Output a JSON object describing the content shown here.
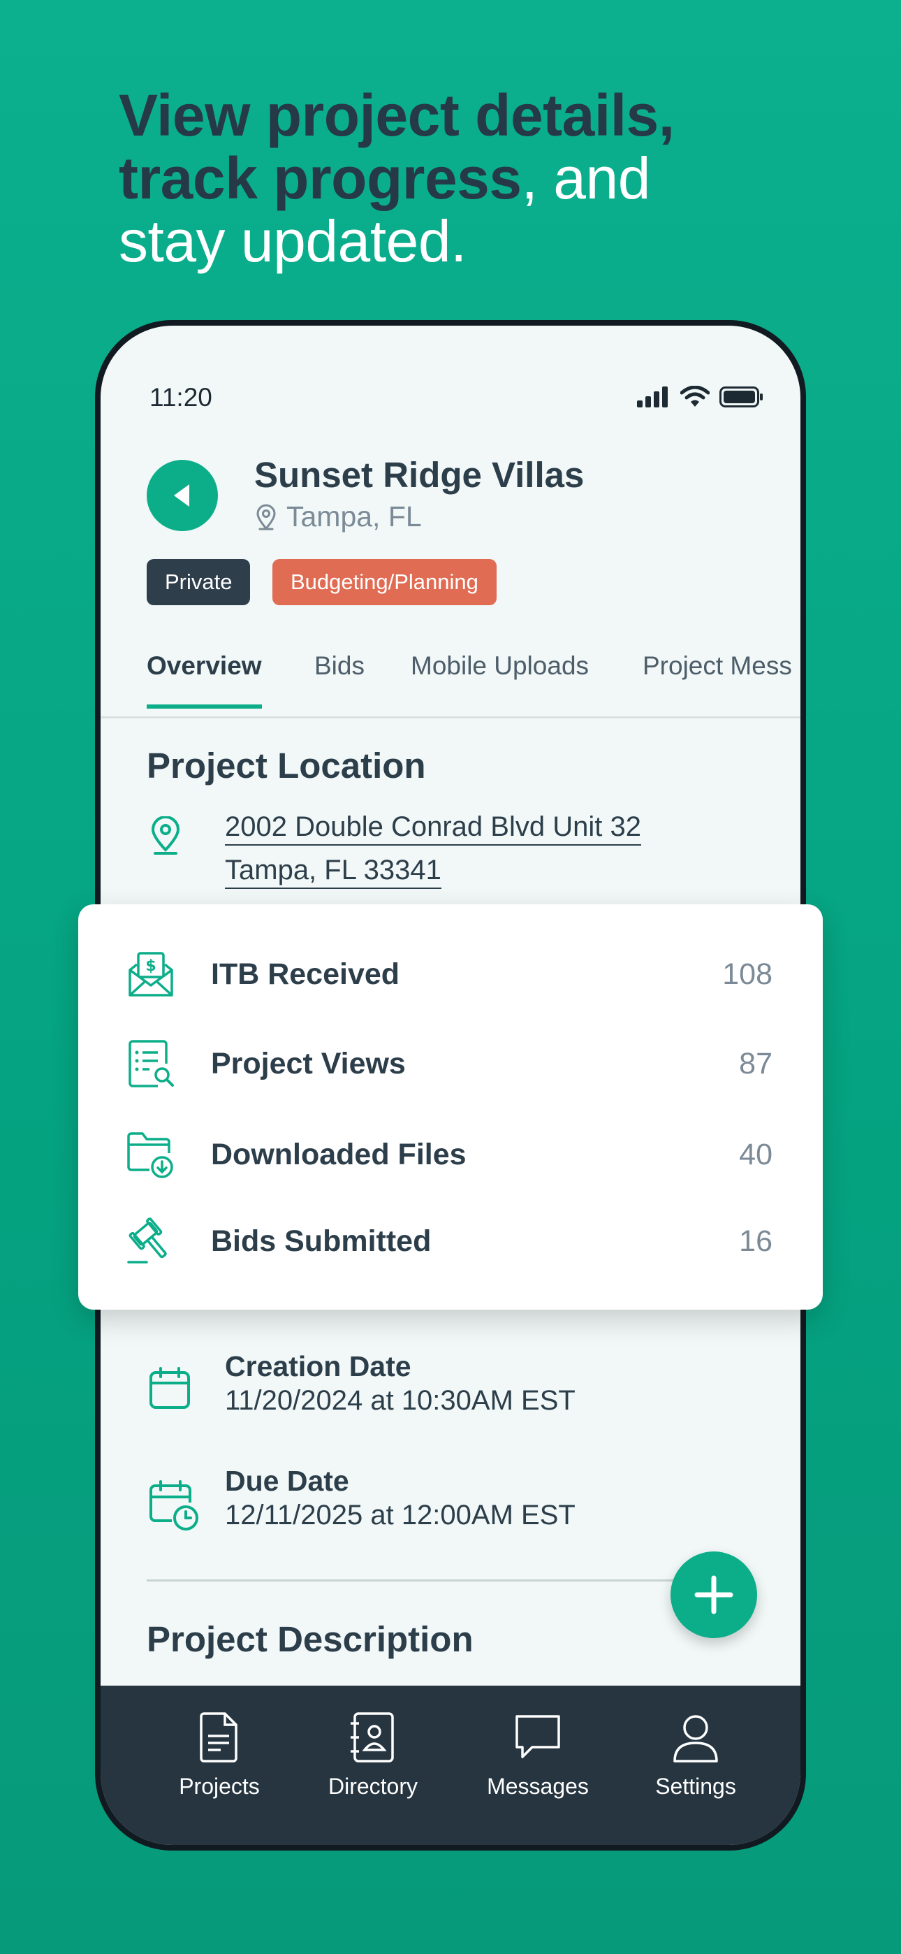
{
  "headline": {
    "dark_1": "View project details,",
    "dark_2": "track progress",
    "light_2": ", and",
    "light_3": "stay updated."
  },
  "status_bar": {
    "time": "11:20"
  },
  "project": {
    "title": "Sunset Ridge Villas",
    "city": "Tampa, FL",
    "badges": {
      "visibility": "Private",
      "stage": "Budgeting/Planning"
    }
  },
  "tabs": [
    "Overview",
    "Bids",
    "Mobile Uploads",
    "Project Mess"
  ],
  "location": {
    "title": "Project Location",
    "address_line1": "2002 Double Conrad Blvd Unit 32",
    "address_line2": "Tampa, FL 33341"
  },
  "stats": [
    {
      "label": "ITB Received",
      "value": "108",
      "icon": "envelope-dollar-icon"
    },
    {
      "label": "Project Views",
      "value": "87",
      "icon": "document-search-icon"
    },
    {
      "label": "Downloaded Files",
      "value": "40",
      "icon": "folder-download-icon"
    },
    {
      "label": "Bids Submitted",
      "value": "16",
      "icon": "gavel-icon"
    }
  ],
  "dates": {
    "creation": {
      "label": "Creation Date",
      "value": "11/20/2024 at 10:30AM EST"
    },
    "due": {
      "label": "Due Date",
      "value": "12/11/2025 at 12:00AM EST"
    }
  },
  "description": {
    "title": "Project Description"
  },
  "bottom_nav": [
    "Projects",
    "Directory",
    "Messages",
    "Settings"
  ],
  "colors": {
    "accent": "#0cae8a",
    "background": "#05a381",
    "dark": "#263540",
    "stage_badge": "#e06c54"
  }
}
